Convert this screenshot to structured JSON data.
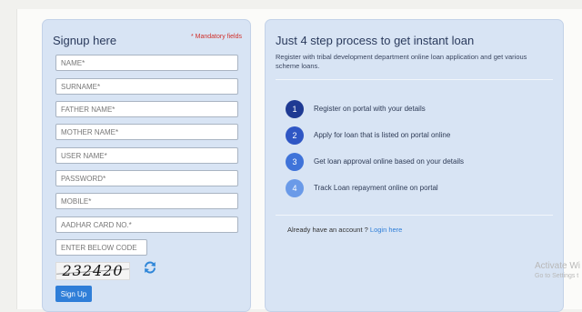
{
  "signup": {
    "title": "Signup here",
    "mandatory_note": "* Mandatory fields",
    "fields": {
      "name": "NAME*",
      "surname": "SURNAME*",
      "father_name": "FATHER NAME*",
      "mother_name": "MOTHER NAME*",
      "user_name": "USER NAME*",
      "password": "PASSWORD*",
      "mobile": "MOBILE*",
      "aadhar": "AADHAR CARD NO.*",
      "code": "ENTER BELOW CODE"
    },
    "captcha_text": "232420",
    "submit_label": "Sign Up"
  },
  "info": {
    "title": "Just 4 step process to get instant loan",
    "description": "Register with tribal development department online loan application and get various scheme loans.",
    "steps": [
      {
        "number": "1",
        "text": "Register on portal with your details",
        "color": "#1f3a93"
      },
      {
        "number": "2",
        "text": "Apply for loan that is listed on portal online",
        "color": "#2f56c4"
      },
      {
        "number": "3",
        "text": "Get loan approval online based on your details",
        "color": "#3f73d9"
      },
      {
        "number": "4",
        "text": "Track Loan repayment online on portal",
        "color": "#6a9ae8"
      }
    ],
    "login_prompt": "Already have an account ?",
    "login_link": "Login here"
  },
  "watermark": {
    "line1": "Activate Wi",
    "line2": "Go to Settings t"
  },
  "colors": {
    "panel_bg": "#d8e4f4",
    "accent": "#2f7ed8",
    "mandatory": "#d0302b"
  }
}
